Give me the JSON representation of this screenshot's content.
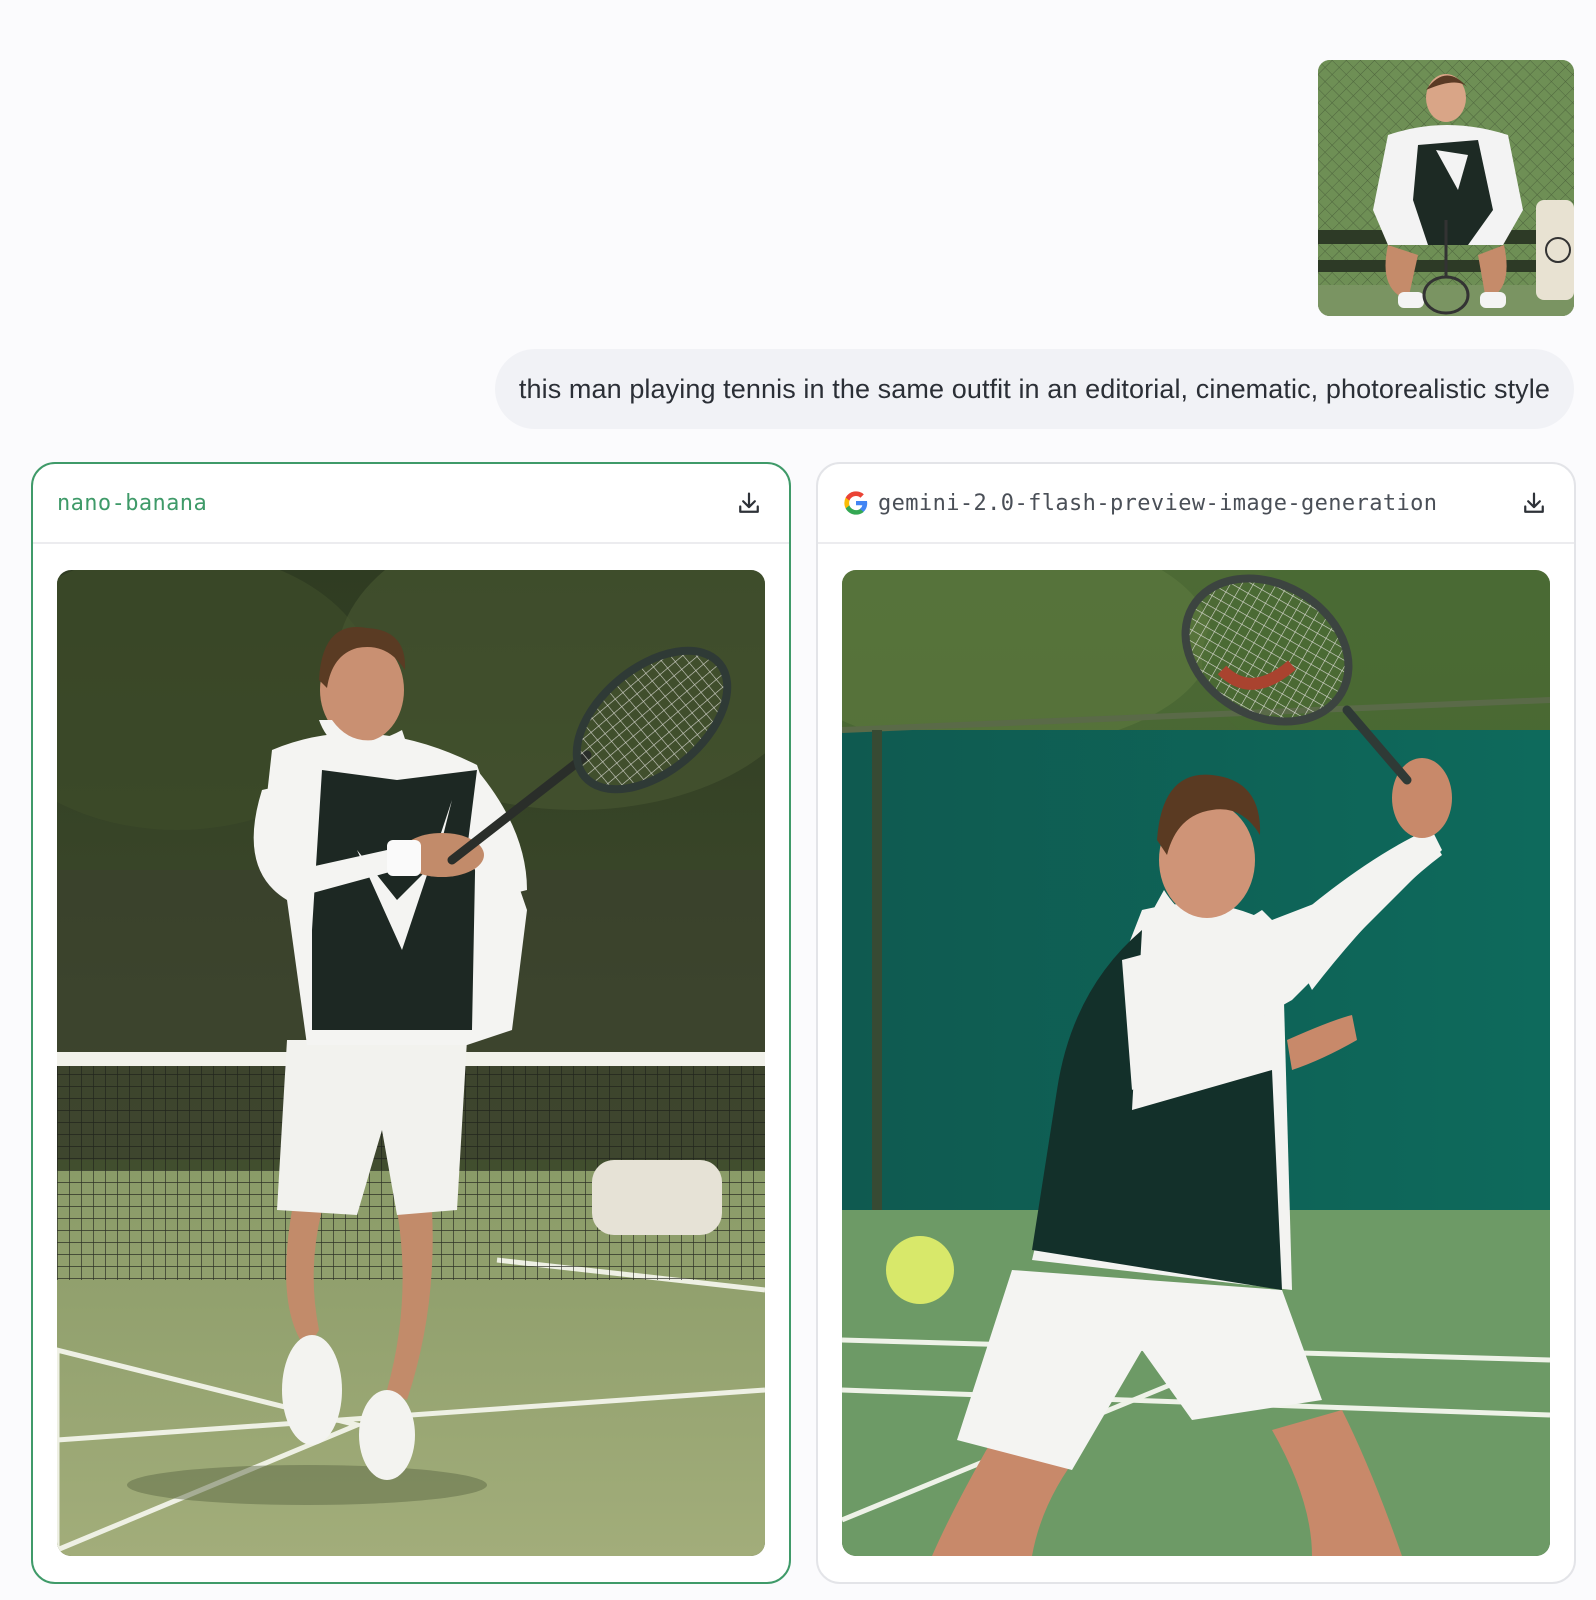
{
  "reference_image": {
    "icon": "photo-thumbnail",
    "depicts": "man crouching on tennis court bench holding racket"
  },
  "prompt": {
    "text": "this man playing tennis in the same outfit in an editorial, cinematic, photorealistic style"
  },
  "results": [
    {
      "model_name": "nano-banana",
      "selected": true,
      "accent_color": "#3f9a69",
      "download_icon": "download-icon"
    },
    {
      "model_name": "gemini-2.0-flash-preview-image-generation",
      "selected": false,
      "provider_icon": "google-logo-icon",
      "download_icon": "download-icon"
    }
  ]
}
